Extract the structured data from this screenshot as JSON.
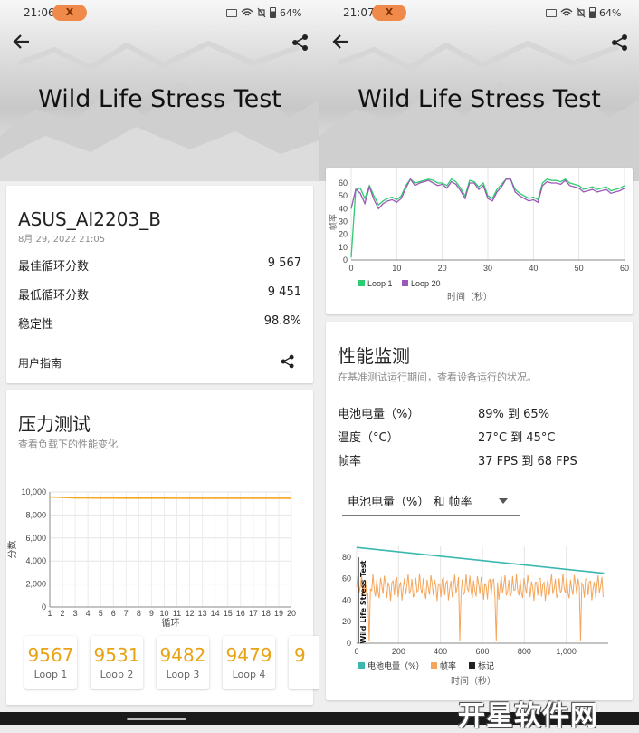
{
  "left": {
    "status": {
      "time": "21:06",
      "badge": "X",
      "battery": "64%"
    },
    "title": "Wild Life Stress Test",
    "device": {
      "name": "ASUS_AI2203_B",
      "date": "8月 29, 2022 21:05"
    },
    "stats": [
      {
        "label": "最佳循环分数",
        "value": "9 567"
      },
      {
        "label": "最低循环分数",
        "value": "9 451"
      },
      {
        "label": "稳定性",
        "value": "98.8%"
      }
    ],
    "user_guide": "用户指南",
    "stress": {
      "title": "压力测试",
      "subtitle": "查看负载下的性能变化"
    },
    "loops": [
      {
        "score": "9567",
        "label": "Loop 1"
      },
      {
        "score": "9531",
        "label": "Loop 2"
      },
      {
        "score": "9482",
        "label": "Loop 3"
      },
      {
        "score": "9479",
        "label": "Loop 4"
      },
      {
        "score": "9",
        "label": ""
      }
    ]
  },
  "right": {
    "status": {
      "time": "21:07",
      "badge": "X",
      "battery": "64%"
    },
    "title": "Wild Life Stress Test",
    "monitor": {
      "title": "性能监测",
      "subtitle": "在基准测试运行期间，查看设备运行的状况。"
    },
    "metrics": [
      {
        "label": "电池电量（%）",
        "value": "89% 到 65%"
      },
      {
        "label": "温度（°C）",
        "value": "27°C 到 45°C"
      },
      {
        "label": "帧率",
        "value": "37 FPS 到 68 FPS"
      }
    ],
    "dropdown": "电池电量（%） 和 帧率"
  },
  "watermark": "开星软件网",
  "chart_data": [
    {
      "type": "line",
      "ylabel": "分数",
      "xlabel": "循环",
      "ylim": [
        0,
        10000
      ],
      "yticks": [
        "0",
        "2,000",
        "4,000",
        "6,000",
        "8,000",
        "10,000"
      ],
      "x": [
        1,
        2,
        3,
        4,
        5,
        6,
        7,
        8,
        9,
        10,
        11,
        12,
        13,
        14,
        15,
        16,
        17,
        18,
        19,
        20
      ],
      "series": [
        {
          "values": [
            9567,
            9531,
            9482,
            9479,
            9475,
            9470,
            9466,
            9465,
            9462,
            9460,
            9458,
            9457,
            9456,
            9455,
            9454,
            9453,
            9452,
            9452,
            9451,
            9451
          ],
          "color": "#f5a623"
        }
      ]
    },
    {
      "type": "line",
      "ylabel": "帧率",
      "xlabel": "时间（秒）",
      "xlim": [
        0,
        60
      ],
      "ylim": [
        0,
        60
      ],
      "xticks": [
        "0",
        "10",
        "20",
        "30",
        "40",
        "50",
        "60"
      ],
      "yticks": [
        "0",
        "10",
        "20",
        "30",
        "40",
        "50",
        "60"
      ],
      "series": [
        {
          "name": "Loop 1",
          "color": "#2ecc71",
          "x": [
            0,
            1,
            2,
            3,
            4,
            5,
            6,
            7,
            8,
            9,
            10,
            11,
            12,
            13,
            14,
            15,
            16,
            17,
            18,
            19,
            20,
            21,
            22,
            23,
            24,
            25,
            26,
            27,
            28,
            29,
            30,
            31,
            32,
            33,
            34,
            35,
            36,
            37,
            38,
            39,
            40,
            41,
            42,
            43,
            44,
            45,
            46,
            47,
            48,
            49,
            50,
            51,
            52,
            53,
            54,
            55,
            56,
            57,
            58,
            59,
            60
          ],
          "y": [
            2,
            55,
            56,
            48,
            58,
            50,
            43,
            46,
            48,
            49,
            47,
            50,
            58,
            66,
            60,
            61,
            62,
            63,
            62,
            60,
            60,
            58,
            63,
            61,
            56,
            50,
            62,
            61,
            57,
            60,
            50,
            48,
            55,
            59,
            66,
            65,
            55,
            52,
            50,
            48,
            49,
            47,
            60,
            63,
            62,
            62,
            61,
            64,
            60,
            59,
            58,
            55,
            56,
            57,
            55,
            56,
            57,
            54,
            55,
            56,
            58
          ]
        },
        {
          "name": "Loop 20",
          "color": "#9b59b6",
          "x": [
            0,
            1,
            2,
            3,
            4,
            5,
            6,
            7,
            8,
            9,
            10,
            11,
            12,
            13,
            14,
            15,
            16,
            17,
            18,
            19,
            20,
            21,
            22,
            23,
            24,
            25,
            26,
            27,
            28,
            29,
            30,
            31,
            32,
            33,
            34,
            35,
            36,
            37,
            38,
            39,
            40,
            41,
            42,
            43,
            44,
            45,
            46,
            47,
            48,
            49,
            50,
            51,
            52,
            53,
            54,
            55,
            56,
            57,
            58,
            59,
            60
          ],
          "y": [
            40,
            55,
            52,
            44,
            57,
            47,
            40,
            44,
            46,
            47,
            45,
            48,
            56,
            64,
            58,
            60,
            61,
            62,
            60,
            58,
            59,
            56,
            61,
            59,
            54,
            48,
            60,
            60,
            55,
            58,
            48,
            46,
            53,
            57,
            64,
            63,
            53,
            50,
            48,
            46,
            47,
            45,
            58,
            61,
            60,
            60,
            59,
            62,
            58,
            57,
            56,
            53,
            54,
            55,
            53,
            54,
            55,
            52,
            53,
            54,
            56
          ]
        }
      ]
    },
    {
      "type": "line",
      "xlabel": "时间（秒）",
      "xlim": [
        0,
        1200
      ],
      "ylim": [
        0,
        90
      ],
      "xticks": [
        "0",
        "200",
        "400",
        "600",
        "800",
        "1,000"
      ],
      "yticks": [
        "0",
        "20",
        "40",
        "60",
        "80"
      ],
      "annotation": "Wild Life Stress Test",
      "series": [
        {
          "name": "电池电量（%）",
          "color": "#3ab8b0",
          "x": [
            0,
            1180
          ],
          "y": [
            89,
            65
          ]
        },
        {
          "name": "帧率",
          "color": "#f5a65b"
        }
      ],
      "legend_extra": "标记"
    }
  ]
}
